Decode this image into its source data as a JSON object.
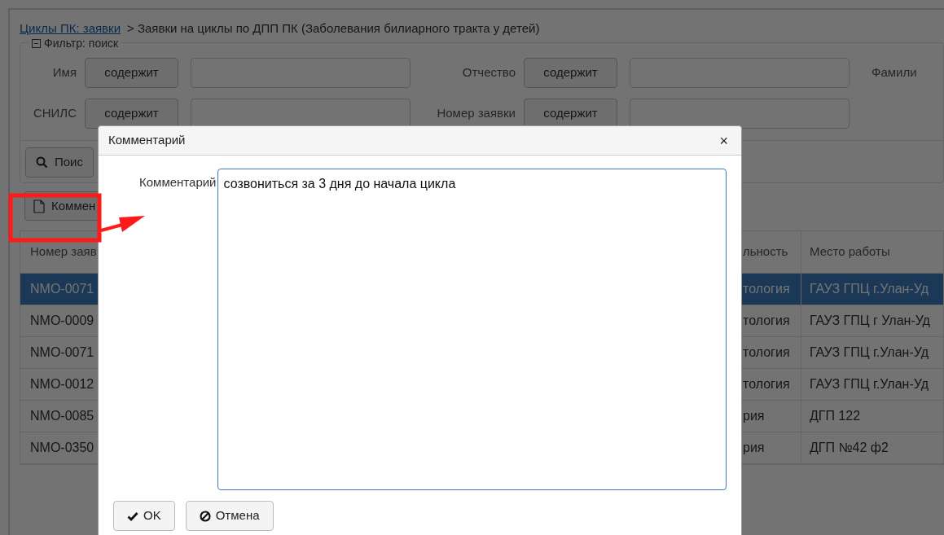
{
  "breadcrumb": {
    "link": "Циклы ПК: заявки",
    "current": "> Заявки на циклы по ДПП ПК (Заболевания билиарного тракта у детей)"
  },
  "filter": {
    "legend": "Фильтр: поиск",
    "expanded": true,
    "rows": [
      [
        {
          "label": "Имя",
          "operator": "содержит"
        },
        {
          "label": "Отчество",
          "operator": "содержит"
        },
        {
          "label": "Фамили"
        }
      ],
      [
        {
          "label": "СНИЛС",
          "operator": "содержит"
        },
        {
          "label": "Номер заявки",
          "operator": "содержит"
        }
      ]
    ]
  },
  "search_button": "Поис",
  "toolbar": {
    "comment_button": "Коммен"
  },
  "table": {
    "columns": [
      "Номер заяв",
      "льность",
      "Место работы"
    ],
    "rows": [
      {
        "cells": [
          "NMO-0071",
          "тология",
          "ГАУЗ ГПЦ г.Улан-Уд"
        ],
        "selected": true
      },
      {
        "cells": [
          "NMO-0009",
          "тология",
          "ГАУЗ ГПЦ г Улан-Уд"
        ],
        "selected": false
      },
      {
        "cells": [
          "NMO-0071",
          "тология",
          "ГАУЗ ГПЦ г.Улан-Уд"
        ],
        "selected": false
      },
      {
        "cells": [
          "NMO-0012",
          "тология",
          "ГАУЗ ГПЦ г.Улан-Уд"
        ],
        "selected": false
      },
      {
        "cells": [
          "NMO-0085",
          "рия",
          "ДГП 122"
        ],
        "selected": false
      },
      {
        "cells": [
          "NMO-0350",
          "рия",
          "ДГП №42 ф2"
        ],
        "selected": false
      }
    ]
  },
  "dialog": {
    "title": "Комментарий",
    "close": "×",
    "field_label": "Комментарий",
    "value": "созвониться за 3 дня до начала цикла",
    "buttons": [
      {
        "kind": "ok",
        "label": "OK"
      },
      {
        "kind": "cancel",
        "label": "Отмена"
      }
    ]
  }
}
